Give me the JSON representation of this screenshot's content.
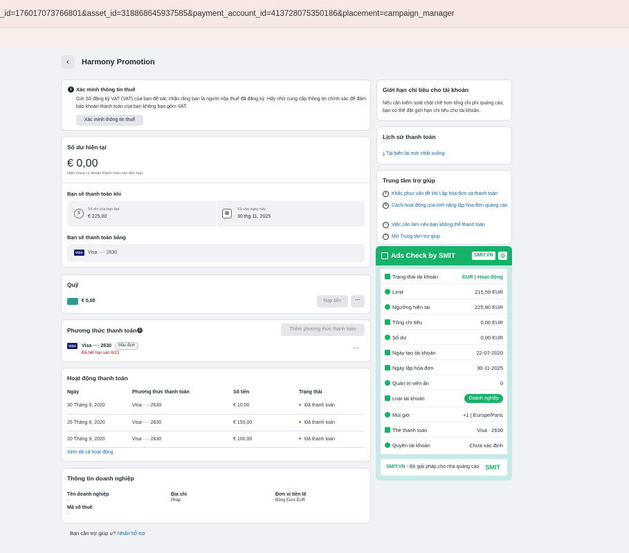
{
  "browser": {
    "url": "_id=176017073766801&asset_id=318868645937585&payment_account_id=413728075350186&placement=campaign_manager"
  },
  "header": {
    "back_icon": "‹",
    "title": "Harmony Promotion"
  },
  "vat_notice": {
    "title": "Xác minh thông tin thuế",
    "description": "Gửi Số đăng ký VAT (VAT) của bạn để xác nhận rằng bạn là người nộp thuế đã đăng ký. Hãy nhớ cung cấp thông tin chính xác để đảm bảo khoản thanh toán của bạn không bao gồm VAT.",
    "button": "Xác minh thông tin thuế"
  },
  "balance": {
    "title": "Số dư hiện tại",
    "amount": "€ 0,00",
    "note": "Hiện chưa có khoản thanh toán nào đến hạn.",
    "when_title": "Bạn sẽ thanh toán khi",
    "threshold_label": "Số dư của bạn đạt",
    "threshold_value": "€ 225,00",
    "date_label": "Và vào ngày này",
    "date_value": "30 thg 11, 2025",
    "method_title": "Bạn sẽ thanh toán bằng",
    "card": "Visa ···· 2630"
  },
  "funds": {
    "title": "Quỹ",
    "amount": "€ 0,00",
    "add_button": "Nạp tiền",
    "more": "···"
  },
  "payment_methods": {
    "title": "Phương thức thanh toán",
    "add_button": "Thêm phương thức thanh toán",
    "card": "Visa ···· 2630",
    "default_badge": "Mặc định",
    "expired": "Đã hết hạn vào 6/23",
    "more": "···"
  },
  "activity": {
    "title": "Hoạt động thanh toán",
    "columns": [
      "Ngày",
      "Phương thức thanh toán",
      "Số tiền",
      "Trạng thái"
    ],
    "rows": [
      [
        "30 Tháng 9, 2020",
        "Visa ···· 2630",
        "€ 10,00",
        "Đã thanh toán"
      ],
      [
        "25 Tháng 9, 2020",
        "Visa ···· 2630",
        "€ 150,00",
        "Đã thanh toán"
      ],
      [
        "20 Tháng 9, 2020",
        "Visa ···· 2630",
        "€ 100,00",
        "Đã thanh toán"
      ]
    ],
    "view_all": "Xem tất cả hoạt động"
  },
  "business": {
    "title": "Thông tin doanh nghiệp",
    "name_label": "Tên doanh nghiệp",
    "name_value": "-",
    "address_label": "Địa chỉ",
    "address_value": "Pháp",
    "currency_label": "Đơn vị tiền tệ",
    "currency_value": "Đồng Euro EUR",
    "tax_label": "Mã số thuế",
    "tax_value": "-"
  },
  "help_footer": {
    "text": "Bạn cần trợ giúp ư?",
    "link": "Nhấn hỗ trợ"
  },
  "spend_limit": {
    "title": "Giới hạn chi tiêu cho tài khoản",
    "description": "Nếu cần kiểm soát chặt chẽ hơn tổng chi phí quảng cáo, bạn có thể đặt giới hạn chi tiêu cho tài khoản."
  },
  "history": {
    "title": "Lịch sử thanh toán",
    "link": "Tải biên lai mới nhất xuống"
  },
  "help_center": {
    "title": "Trung tâm trợ giúp",
    "items": [
      "Khắc phục vấn đề khi Lập hóa đơn và thanh toán",
      "Cách hoạt động của tính năng lập hóa đơn quảng cáo",
      "Việc cần làm nếu bạn không thể thanh toán",
      "Mở Trung tâm trợ giúp"
    ]
  },
  "ads_check": {
    "title": "Ads Check by SMIT",
    "badge": "SMIT.VN",
    "accent": "#17b26a",
    "rows": [
      {
        "label": "Trạng thái tài khoản",
        "value": "EUR | Hoạt động"
      },
      {
        "label": "Limit",
        "value": "215,59 EUR"
      },
      {
        "label": "Ngưỡng hiện tại",
        "value": "225,00 EUR"
      },
      {
        "label": "Tổng chi tiêu",
        "value": "0,00 EUR"
      },
      {
        "label": "Số dư",
        "value": "0,00 EUR"
      },
      {
        "label": "Ngày tạo tài khoản",
        "value": "22-07-2020"
      },
      {
        "label": "Ngày lập hóa đơn",
        "value": "30-11-2025"
      },
      {
        "label": "Quản trị viên ẩn",
        "value": "0"
      },
      {
        "label": "Loại tài khoản",
        "value": "Doanh nghiệp"
      },
      {
        "label": "Múi giờ",
        "value": "+1 | Europe/Paris"
      },
      {
        "label": "Thẻ thanh toán",
        "value": "Visa · 2630"
      },
      {
        "label": "Quyền tài khoản",
        "value": "Chưa xác định"
      }
    ],
    "footer_brand": "SMIT.VN",
    "footer_text": " - Bộ giải pháp cho nhà quảng cáo",
    "footer_logo": "SMIT"
  }
}
